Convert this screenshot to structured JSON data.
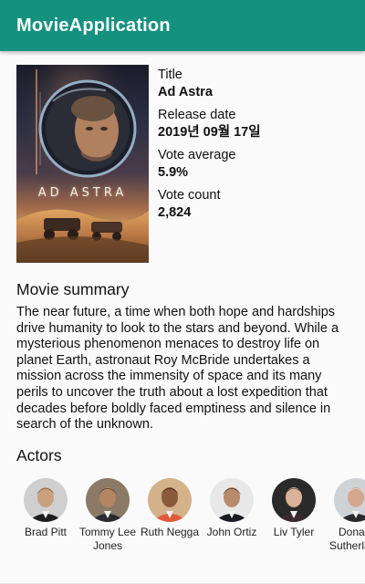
{
  "app_bar": {
    "title": "MovieApplication",
    "color": "#14927f"
  },
  "movie": {
    "poster_title": "AD ASTRA",
    "title_label": "Title",
    "title": "Ad Astra",
    "release_label": "Release date",
    "release_date": "2019년 09월 17일",
    "vote_average_label": "Vote average",
    "vote_average": "5.9%",
    "vote_count_label": "Vote count",
    "vote_count": "2,824"
  },
  "summary": {
    "heading": "Movie summary",
    "text": "The near future, a time when both hope and hardships drive humanity to look to the stars and beyond. While a mysterious phenomenon menaces to destroy life on planet Earth, astronaut Roy McBride undertakes a mission across the immensity of space and its many perils to uncover the truth about a lost expedition that decades before boldly faced emptiness and silence in search of the unknown."
  },
  "actors": {
    "heading": "Actors",
    "items": [
      {
        "name": "Brad Pitt",
        "skin": "#c9a07e",
        "hair": "#5a4632",
        "bg": "#cfcfcf",
        "suit": "#1d1d1f"
      },
      {
        "name": "Tommy Lee Jones",
        "skin": "#b48463",
        "hair": "#3a2a22",
        "bg": "#8a7a66",
        "suit": "#2b2b30"
      },
      {
        "name": "Ruth Negga",
        "skin": "#8a5a3c",
        "hair": "#2a1a12",
        "bg": "#d4b28a",
        "suit": "#e05a3a"
      },
      {
        "name": "John Ortiz",
        "skin": "#b78a6a",
        "hair": "#222222",
        "bg": "#e8e8e8",
        "suit": "#1a1a22"
      },
      {
        "name": "Liv Tyler",
        "skin": "#d9b29a",
        "hair": "#3a2418",
        "bg": "#2a2a2a",
        "suit": "#3b2a30"
      },
      {
        "name": "Donald Sutherland",
        "skin": "#d2a88e",
        "hair": "#e8e4de",
        "bg": "#cfd3d8",
        "suit": "#2a2a2e"
      }
    ]
  }
}
